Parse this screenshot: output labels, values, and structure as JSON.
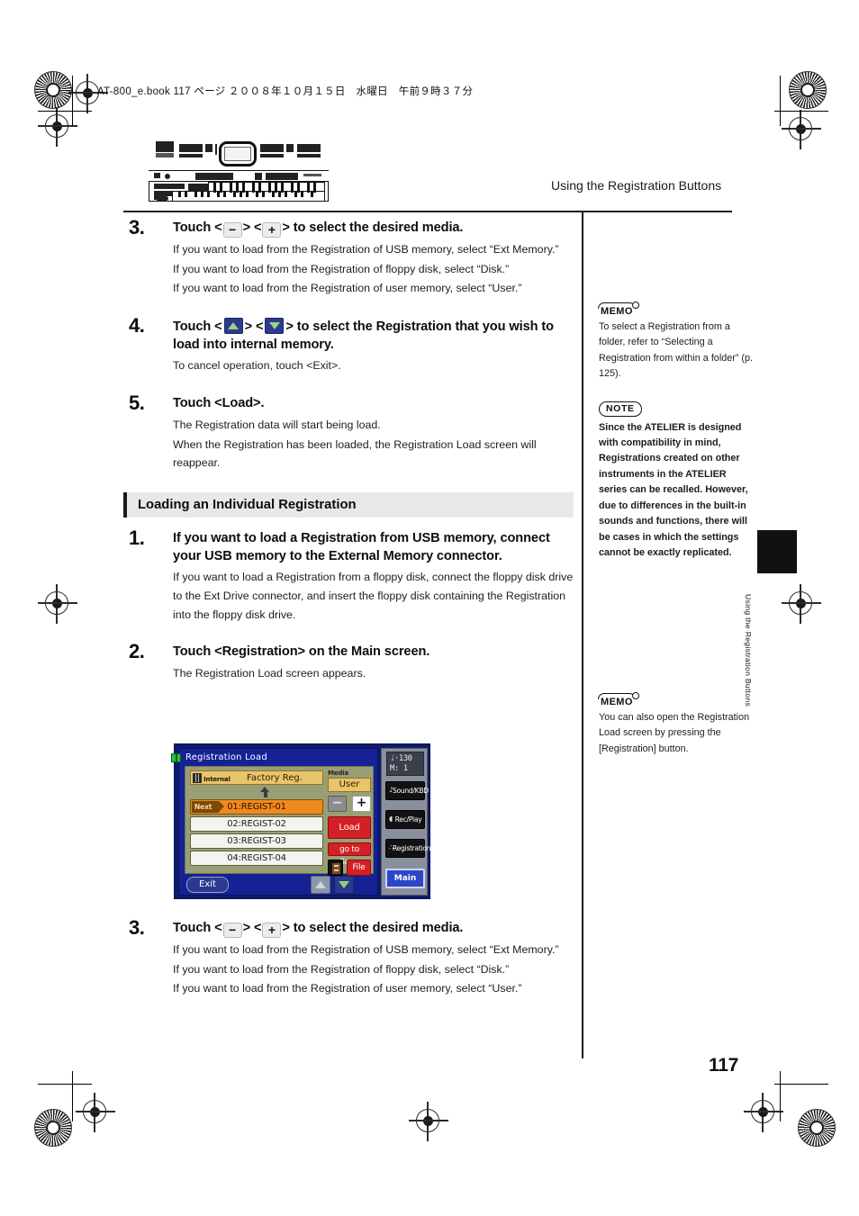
{
  "print_header": "AT-800_e.book  117 ページ  ２００８年１０月１５日　水曜日　午前９時３７分",
  "running_head": "Using the Registration Buttons",
  "page_number": "117",
  "thumb_tab_label": "Using the Registration Buttons",
  "steps_top": [
    {
      "num": "3.",
      "title_pre": "Touch <",
      "key1": "−",
      "title_mid": "> <",
      "key2": "+",
      "title_post": "> to select the desired media.",
      "body": [
        "If you want to load from the Registration of USB memory, select “Ext Memory.”",
        "If you want to load from the Registration of floppy disk, select “Disk.”",
        "If you want to load from the Registration of user memory, select “User.”"
      ]
    },
    {
      "num": "4.",
      "title_pre": "Touch <",
      "title_mid": "> <",
      "title_post": "> to select the Registration that you wish to load into internal memory.",
      "body": [
        "To cancel operation, touch <Exit>."
      ]
    },
    {
      "num": "5.",
      "title": "Touch <Load>.",
      "body": [
        "The Registration data will start being load.",
        "When the Registration has been loaded, the Registration Load screen will reappear."
      ]
    }
  ],
  "section_heading": "Loading an Individual Registration",
  "steps_bottom": [
    {
      "num": "1.",
      "title": "If you want to load a Registration from USB memory, connect your USB memory to the External Memory connector.",
      "body": [
        "If you want to load a Registration from a floppy disk, connect the floppy disk drive to the Ext Drive connector, and insert the floppy disk containing the Registration into the floppy disk drive."
      ]
    },
    {
      "num": "2.",
      "title": "Touch <Registration> on the Main screen.",
      "body": [
        "The Registration Load screen appears."
      ]
    },
    {
      "num": "3.",
      "title_pre": "Touch <",
      "key1": "−",
      "title_mid": "> <",
      "key2": "+",
      "title_post": "> to select the desired media.",
      "body": [
        "If you want to load from the Registration of USB memory, select “Ext Memory.”",
        "If you want to load from the Registration of floppy disk, select “Disk.”",
        "If you want to load from the Registration of user memory, select “User.”"
      ]
    }
  ],
  "sidebar": {
    "memo1": {
      "tag": "MEMO",
      "text": "To select a Registration from a folder, refer to “Selecting a Registration from within a folder” (p. 125)."
    },
    "note1": {
      "tag": "NOTE",
      "text": "Since the ATELIER is designed with compatibility in mind, Registrations created on other instruments in the ATELIER series can be recalled. However, due to differences in the built-in sounds and functions, there will be cases in which the settings cannot be exactly replicated."
    },
    "memo2": {
      "tag": "MEMO",
      "text": "You can also open the Registration Load screen by pressing the [Registration] button."
    }
  },
  "lcd": {
    "title": "Registration Load",
    "folder_tag": "Internal",
    "folder_name": "Factory Reg.",
    "registrations": [
      {
        "badge": "Next",
        "label": "01:REGIST-01",
        "selected": true
      },
      {
        "badge": "",
        "label": "02:REGIST-02",
        "selected": false
      },
      {
        "badge": "",
        "label": "03:REGIST-03",
        "selected": false
      },
      {
        "badge": "",
        "label": "04:REGIST-04",
        "selected": false
      }
    ],
    "media_label": "Media",
    "media_value": "User",
    "minus_label": "−",
    "plus_label": "+",
    "load_label": "Load",
    "go_to_save_label": "go to Save",
    "file_label": "File",
    "exit_label": "Exit",
    "tempo_line1": "♩·130",
    "tempo_line2": "M:    1",
    "side_buttons": [
      {
        "glyph": "♪",
        "label": "Sound/KBD"
      },
      {
        "glyph": "◖",
        "label": "Rec/Play"
      },
      {
        "glyph": "∴",
        "label": "Registration"
      }
    ],
    "main_label": "Main",
    "accent_orange": "#f08a1c",
    "accent_red": "#d51f26",
    "accent_blue": "#2b3a8f",
    "accent_yellow": "#e8c569"
  }
}
